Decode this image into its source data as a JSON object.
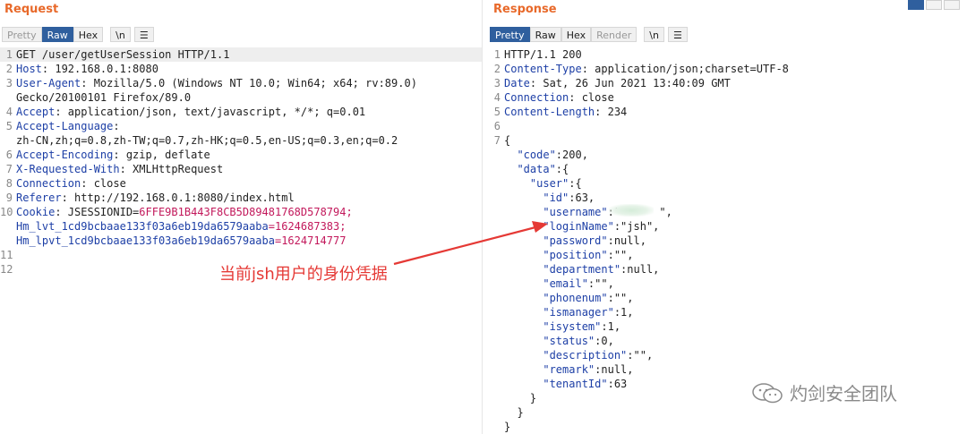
{
  "request": {
    "title": "Request",
    "tabs": [
      "Pretty",
      "Raw",
      "Hex"
    ],
    "newline_btn": "\\n",
    "lines": [
      {
        "n": "1",
        "key": "GET /user/getUserSession HTTP/1.1"
      },
      {
        "n": "2",
        "key": "Host",
        "val": ": 192.168.0.1:8080"
      },
      {
        "n": "3",
        "key": "User-Agent",
        "val": ": Mozilla/5.0 (Windows NT 10.0; Win64; x64; rv:89.0)"
      },
      {
        "n": "",
        "val": "Gecko/20100101 Firefox/89.0"
      },
      {
        "n": "4",
        "key": "Accept",
        "val": ": application/json, text/javascript, */*; q=0.01"
      },
      {
        "n": "5",
        "key": "Accept-Language",
        "val": ":"
      },
      {
        "n": "",
        "val": "zh-CN,zh;q=0.8,zh-TW;q=0.7,zh-HK;q=0.5,en-US;q=0.3,en;q=0.2"
      },
      {
        "n": "6",
        "key": "Accept-Encoding",
        "val": ": gzip, deflate"
      },
      {
        "n": "7",
        "key": "X-Requested-With",
        "val": ": XMLHttpRequest"
      },
      {
        "n": "8",
        "key": "Connection",
        "val": ": close"
      },
      {
        "n": "9",
        "key": "Referer",
        "val": ": http://192.168.0.1:8080/index.html"
      },
      {
        "n": "10",
        "key": "Cookie",
        "val": ": JSESSIONID=",
        "c": "6FFE9B1B443F8CB5D89481768D578794;"
      },
      {
        "n": "",
        "key": "Hm_lvt_1cd9bcbaae133f03a6eb19da6579aaba",
        "c": "=1624687383;"
      },
      {
        "n": "",
        "key": "Hm_lpvt_1cd9bcbaae133f03a6eb19da6579aaba",
        "c": "=1624714777"
      },
      {
        "n": "11"
      },
      {
        "n": "12"
      }
    ]
  },
  "response": {
    "title": "Response",
    "tabs": [
      "Pretty",
      "Raw",
      "Hex",
      "Render"
    ],
    "newline_btn": "\\n",
    "lines": [
      {
        "n": "1",
        "v": "HTTP/1.1 200"
      },
      {
        "n": "2",
        "key": "Content-Type",
        "val": ": application/json;charset=UTF-8"
      },
      {
        "n": "3",
        "key": "Date",
        "val": ": Sat, 26 Jun 2021 13:40:09 GMT"
      },
      {
        "n": "4",
        "key": "Connection",
        "val": ": close"
      },
      {
        "n": "5",
        "key": "Content-Length",
        "val": ": 234"
      },
      {
        "n": "6"
      },
      {
        "n": "7",
        "v": "{"
      },
      {
        "n": "",
        "key": "  \"code\"",
        "val": ":200,"
      },
      {
        "n": "",
        "key": "  \"data\"",
        "val": ":{"
      },
      {
        "n": "",
        "key": "    \"user\"",
        "val": ":{"
      },
      {
        "n": "",
        "key": "      \"id\"",
        "val": ":63,"
      },
      {
        "n": "",
        "key": "      \"username\"",
        "val": ":\"      \","
      },
      {
        "n": "",
        "key": "      \"loginName\"",
        "val": ":\"jsh\","
      },
      {
        "n": "",
        "key": "      \"password\"",
        "val": ":null,"
      },
      {
        "n": "",
        "key": "      \"position\"",
        "val": ":\"\","
      },
      {
        "n": "",
        "key": "      \"department\"",
        "val": ":null,"
      },
      {
        "n": "",
        "key": "      \"email\"",
        "val": ":\"\","
      },
      {
        "n": "",
        "key": "      \"phonenum\"",
        "val": ":\"\","
      },
      {
        "n": "",
        "key": "      \"ismanager\"",
        "val": ":1,"
      },
      {
        "n": "",
        "key": "      \"isystem\"",
        "val": ":1,"
      },
      {
        "n": "",
        "key": "      \"status\"",
        "val": ":0,"
      },
      {
        "n": "",
        "key": "      \"description\"",
        "val": ":\"\","
      },
      {
        "n": "",
        "key": "      \"remark\"",
        "val": ":null,"
      },
      {
        "n": "",
        "key": "      \"tenantId\"",
        "val": ":63"
      },
      {
        "n": "",
        "v": "    }"
      },
      {
        "n": "",
        "v": "  }"
      },
      {
        "n": "",
        "v": "}"
      }
    ]
  },
  "annotation": "当前jsh用户的身份凭据",
  "watermark": "灼剑安全团队",
  "colors": {
    "accent": "#e8692a",
    "active_tab": "#2f5f9e",
    "annotation": "#e53935"
  }
}
